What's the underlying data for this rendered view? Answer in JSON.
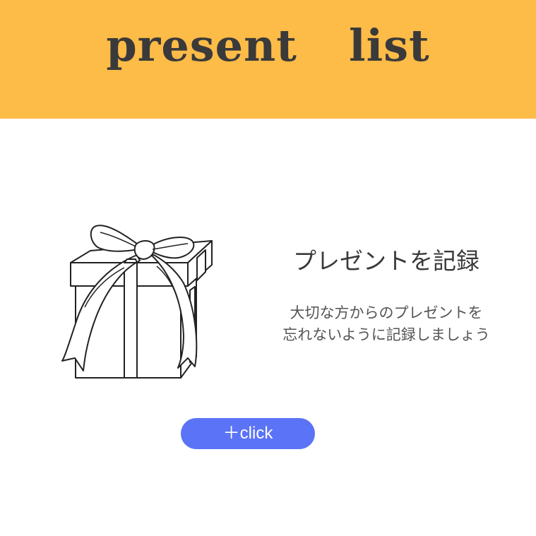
{
  "header": {
    "title": "present  list",
    "background_color": "#FDBB47"
  },
  "main": {
    "illustration": "gift-box-with-ribbon-icon",
    "heading": "プレゼントを記録",
    "description_line1": "大切な方からのプレゼントを",
    "description_line2": "忘れないように記録しましょう"
  },
  "add_button": {
    "label": "＋click",
    "color": "#5B73F6"
  }
}
